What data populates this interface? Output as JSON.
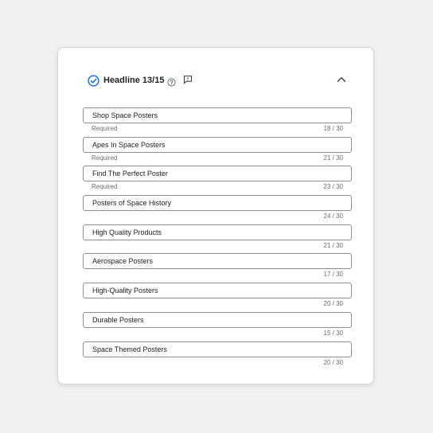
{
  "header": {
    "title": "Headline 13/15"
  },
  "colors": {
    "accent": "#1a73e8",
    "border": "#8f8f8f",
    "meta_text": "#6b6b6b"
  },
  "icons": {
    "status": "check-circle-icon",
    "help": "help-circle-icon",
    "feedback": "feedback-icon",
    "collapse": "chevron-up-icon"
  },
  "fields": [
    {
      "value": "Shop Space Posters",
      "required": "Required",
      "count": "18 / 30"
    },
    {
      "value": "Apes In Space Posters",
      "required": "Required",
      "count": "21 / 30"
    },
    {
      "value": "Find The Perfect Poster",
      "required": "Required",
      "count": "23 / 30"
    },
    {
      "value": "Posters of Space History",
      "required": "",
      "count": "24 / 30"
    },
    {
      "value": "High Quality Products",
      "required": "",
      "count": "21 / 30"
    },
    {
      "value": "Aerospace Posters",
      "required": "",
      "count": "17 / 30"
    },
    {
      "value": "High-Quality Posters",
      "required": "",
      "count": "20 / 30"
    },
    {
      "value": "Durable Posters",
      "required": "",
      "count": "15 / 30"
    },
    {
      "value": "Space Themed Posters",
      "required": "",
      "count": "20 / 30"
    }
  ]
}
